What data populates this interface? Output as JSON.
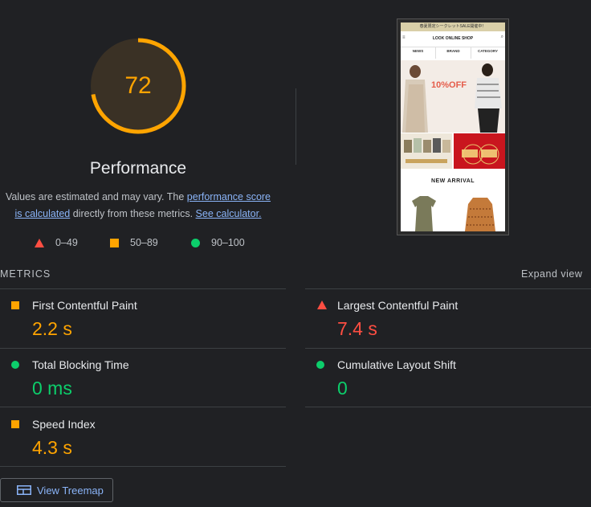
{
  "gauge": {
    "score": "72",
    "score_fraction": 0.72,
    "title": "Performance",
    "color": "#ffa400"
  },
  "description": {
    "prefix": "Values are estimated and may vary. The ",
    "link1": "performance score",
    "link1b": "is calculated",
    "middle": " directly from these metrics. ",
    "link2": "See calculator."
  },
  "legend": [
    {
      "label": "0–49",
      "shape": "triangle",
      "color": "#ff4e42"
    },
    {
      "label": "50–89",
      "shape": "square",
      "color": "#ffa400"
    },
    {
      "label": "90–100",
      "shape": "circle",
      "color": "#0cce6b"
    }
  ],
  "thumbnail": {
    "banner": "春夏限定シークレットSALE開催中！",
    "logo": "LOOK ONLINE SHOP",
    "nav": [
      "NEWS",
      "BRAND",
      "CATEGORY"
    ],
    "hero_offer": "10%OFF",
    "new_arrival": "NEW ARRIVAL"
  },
  "metrics": {
    "title": "METRICS",
    "expand": "Expand view",
    "items": [
      {
        "label": "First Contentful Paint",
        "value": "2.2 s",
        "status": "average",
        "icon": "square-icon"
      },
      {
        "label": "Largest Contentful Paint",
        "value": "7.4 s",
        "status": "fail",
        "icon": "triangle-icon"
      },
      {
        "label": "Total Blocking Time",
        "value": "0 ms",
        "status": "pass",
        "icon": "circle-icon"
      },
      {
        "label": "Cumulative Layout Shift",
        "value": "0",
        "status": "pass",
        "icon": "circle-icon"
      },
      {
        "label": "Speed Index",
        "value": "4.3 s",
        "status": "average",
        "icon": "square-icon"
      }
    ]
  },
  "treemap_button": {
    "label": "View Treemap",
    "icon": "treemap-icon"
  },
  "colors": {
    "fail": "#ff4e42",
    "average": "#ffa400",
    "pass": "#0cce6b",
    "link": "#8ab4f8",
    "background": "#202124"
  }
}
